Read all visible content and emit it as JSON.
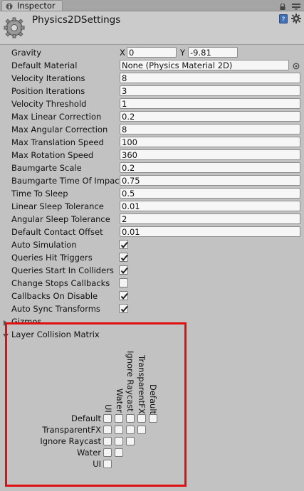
{
  "tab": {
    "label": "Inspector"
  },
  "header": {
    "title": "Physics2DSettings"
  },
  "gravity": {
    "label": "Gravity",
    "x_axis": "X",
    "x_value": "0",
    "y_axis": "Y",
    "y_value": "-9.81"
  },
  "fields": [
    {
      "label": "Default Material",
      "value": "None (Physics Material 2D)"
    },
    {
      "label": "Velocity Iterations",
      "value": "8"
    },
    {
      "label": "Position Iterations",
      "value": "3"
    },
    {
      "label": "Velocity Threshold",
      "value": "1"
    },
    {
      "label": "Max Linear Correction",
      "value": "0.2"
    },
    {
      "label": "Max Angular Correction",
      "value": "8"
    },
    {
      "label": "Max Translation Speed",
      "value": "100"
    },
    {
      "label": "Max Rotation Speed",
      "value": "360"
    },
    {
      "label": "Baumgarte Scale",
      "value": "0.2"
    },
    {
      "label": "Baumgarte Time Of Impact Scale",
      "value": "0.75"
    },
    {
      "label": "Time To Sleep",
      "value": "0.5"
    },
    {
      "label": "Linear Sleep Tolerance",
      "value": "0.01"
    },
    {
      "label": "Angular Sleep Tolerance",
      "value": "2"
    },
    {
      "label": "Default Contact Offset",
      "value": "0.01"
    }
  ],
  "toggles": [
    {
      "label": "Auto Simulation",
      "checked": true
    },
    {
      "label": "Queries Hit Triggers",
      "checked": true
    },
    {
      "label": "Queries Start In Colliders",
      "checked": true
    },
    {
      "label": "Change Stops Callbacks",
      "checked": false
    },
    {
      "label": "Callbacks On Disable",
      "checked": true
    },
    {
      "label": "Auto Sync Transforms",
      "checked": true
    }
  ],
  "gizmos": {
    "label": "Gizmos"
  },
  "matrix": {
    "label": "Layer Collision Matrix",
    "columns": [
      "UI",
      "Water",
      "Ignore Raycast",
      "TransparentFX",
      "Default"
    ],
    "rows": [
      "Default",
      "TransparentFX",
      "Ignore Raycast",
      "Water",
      "UI"
    ]
  }
}
